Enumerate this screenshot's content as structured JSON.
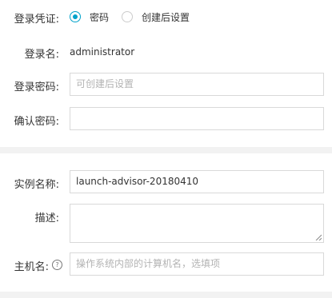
{
  "credentials": {
    "label": "登录凭证:",
    "options": [
      {
        "label": "密码",
        "checked": true
      },
      {
        "label": "创建后设置",
        "checked": false
      }
    ]
  },
  "login_name": {
    "label": "登录名:",
    "value": "administrator"
  },
  "login_password": {
    "label": "登录密码:",
    "placeholder": "可创建后设置"
  },
  "confirm_password": {
    "label": "确认密码:",
    "value": ""
  },
  "instance_name": {
    "label": "实例名称:",
    "value": "launch-advisor-20180410"
  },
  "description": {
    "label": "描述:",
    "value": ""
  },
  "hostname": {
    "label": "主机名:",
    "help_icon": "?",
    "placeholder": "操作系统内部的计算机名，选填项"
  },
  "colors": {
    "accent": "#00a2ca",
    "border": "#d9d9d9",
    "placeholder": "#b3b3b3",
    "separator": "#f2f2f2"
  }
}
